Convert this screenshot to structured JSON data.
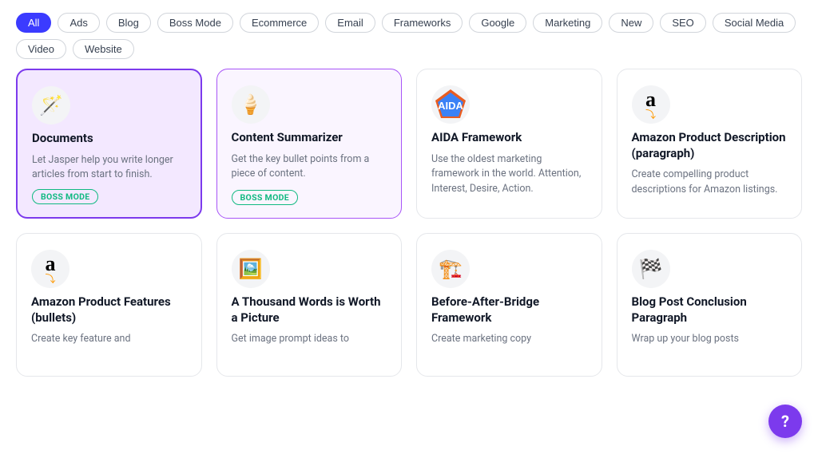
{
  "filters": [
    {
      "label": "All",
      "active": true
    },
    {
      "label": "Ads",
      "active": false
    },
    {
      "label": "Blog",
      "active": false
    },
    {
      "label": "Boss Mode",
      "active": false
    },
    {
      "label": "Ecommerce",
      "active": false
    },
    {
      "label": "Email",
      "active": false
    },
    {
      "label": "Frameworks",
      "active": false
    },
    {
      "label": "Google",
      "active": false
    },
    {
      "label": "Marketing",
      "active": false
    },
    {
      "label": "New",
      "active": false
    },
    {
      "label": "SEO",
      "active": false
    },
    {
      "label": "Social Media",
      "active": false
    },
    {
      "label": "Video",
      "active": false
    },
    {
      "label": "Website",
      "active": false
    }
  ],
  "cards_row1": [
    {
      "id": "documents",
      "title": "Documents",
      "desc": "Let Jasper help you write longer articles from start to finish.",
      "badge": "BOSS MODE",
      "icon_type": "docs",
      "style": "purple-active"
    },
    {
      "id": "content-summarizer",
      "title": "Content Summarizer",
      "desc": "Get the key bullet points from a piece of content.",
      "badge": "BOSS MODE",
      "icon_type": "icecream",
      "style": "purple-border"
    },
    {
      "id": "aida-framework",
      "title": "AIDA Framework",
      "desc": "Use the oldest marketing framework in the world. Attention, Interest, Desire, Action.",
      "badge": "",
      "icon_type": "aida",
      "style": ""
    },
    {
      "id": "amazon-product-desc",
      "title": "Amazon Product Description (paragraph)",
      "desc": "Create compelling product descriptions for Amazon listings.",
      "badge": "",
      "icon_type": "amazon",
      "style": ""
    }
  ],
  "cards_row2": [
    {
      "id": "amazon-bullets",
      "title": "Amazon Product Features (bullets)",
      "desc": "Create key feature and",
      "badge": "",
      "icon_type": "amazon2",
      "style": ""
    },
    {
      "id": "thousand-words",
      "title": "A Thousand Words is Worth a Picture",
      "desc": "Get image prompt ideas to",
      "badge": "",
      "icon_type": "image",
      "style": ""
    },
    {
      "id": "before-after-bridge",
      "title": "Before-After-Bridge Framework",
      "desc": "Create marketing copy",
      "badge": "",
      "icon_type": "bridge",
      "style": ""
    },
    {
      "id": "blog-conclusion",
      "title": "Blog Post Conclusion Paragraph",
      "desc": "Wrap up your blog posts",
      "badge": "",
      "icon_type": "flag",
      "style": ""
    }
  ],
  "help_label": "?"
}
